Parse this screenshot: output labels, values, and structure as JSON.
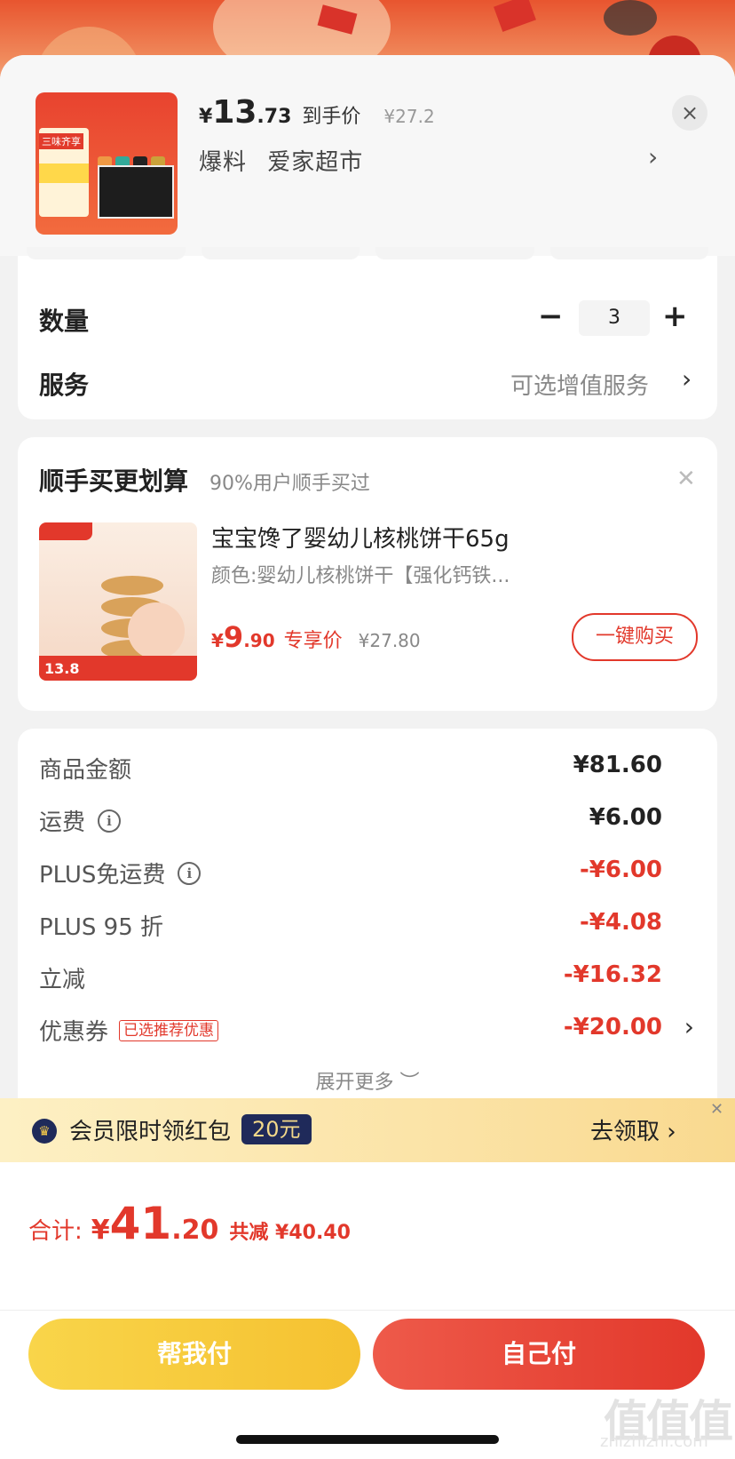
{
  "product": {
    "price_yen": "¥",
    "price_int": "13",
    "price_dec": ".73",
    "price_label": "到手价",
    "original_price": "¥27.2",
    "tag1": "爆料",
    "shop_name": "爱家超市",
    "thumb_text": "三味齐享"
  },
  "options": {
    "quantity_label": "数量",
    "quantity_value": "3",
    "minus": "−",
    "plus": "+",
    "service_label": "服务",
    "service_value": "可选增值服务"
  },
  "addon": {
    "title": "顺手买更划算",
    "subtitle": "90%用户顺手买过",
    "name": "宝宝馋了婴幼儿核桃饼干65g",
    "spec": "颜色:婴幼儿核桃饼干【强化钙铁...",
    "price_yen": "¥",
    "price_int": "9",
    "price_dec": ".90",
    "price_label": "专享价",
    "original_price": "¥27.80",
    "buy_button": "一键购买",
    "img_price": "13.8"
  },
  "summary": {
    "rows": [
      {
        "label": "商品金额",
        "value": "¥81.60"
      },
      {
        "label": "运费",
        "value": "¥6.00"
      },
      {
        "label": "PLUS免运费",
        "value": "-¥6.00"
      },
      {
        "label": "PLUS 95 折",
        "value": "-¥4.08"
      },
      {
        "label": "立减",
        "value": "-¥16.32"
      },
      {
        "label": "优惠券",
        "value": "-¥20.00"
      }
    ],
    "coupon_tag": "已选推荐优惠",
    "expand_more": "展开更多 ︶"
  },
  "member": {
    "text": "会员限时领红包",
    "badge": "20元",
    "cta": "去领取 ›"
  },
  "footer": {
    "total_label": "合计:",
    "total_yen": "¥",
    "total_int": "41",
    "total_dec": ".20",
    "saved": "共减 ¥40.40",
    "help_pay": "帮我付",
    "self_pay": "自己付"
  },
  "watermark": {
    "main": "值值值",
    "sub": "zhizhizhi.com"
  },
  "colors": {
    "accent_red": "#e2382b",
    "accent_yellow": "#f5c130",
    "member_navy": "#1f2a5a"
  }
}
